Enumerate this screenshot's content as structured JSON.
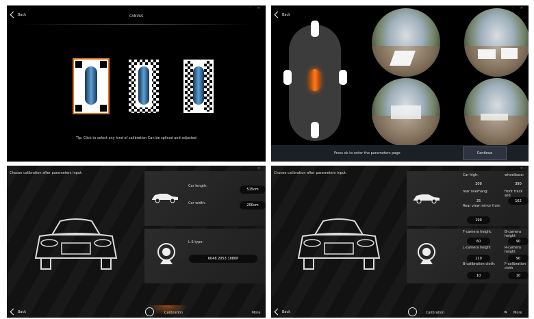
{
  "panel1": {
    "back_label": "Back",
    "title": "CANVAS",
    "tip": "Tip: Click to select any kind of calibration Can be spliced and adjusted",
    "window_controls": "- ×"
  },
  "panel2": {
    "back_label": "Back",
    "status_text": "Press ok to enter the parameters page",
    "continue_label": "Continue",
    "window_controls": "- ×"
  },
  "panel3": {
    "heading": "Choose calibration after parameters input:",
    "car_length_label": "Car length:",
    "car_length_value": "515cm",
    "car_width_label": "Car width:",
    "car_width_value": "200cm",
    "ls_type_label": "L-S type:",
    "ls_type_value": "6048 2053 1080P",
    "back_label": "Back",
    "calibration_label": "Calibration",
    "more_label": "More",
    "window_controls": "- ×"
  },
  "panel4": {
    "heading": "Choose calibration after parameters input:",
    "car_high_label": "Car high:",
    "car_high_value": "200",
    "wheelbase_label": "wheelbase:",
    "wheelbase_value": "390",
    "rear_overhang_label": "rear overhang:",
    "rear_overhang_value": "25",
    "front_track_label": "front track wid",
    "front_track_value": "162",
    "rear_view_label": "Rear view mirror from",
    "rear_view_value": "190",
    "f_camera_label": "F-camera height:",
    "f_camera_value": "60",
    "b_camera_label": "B-camera height",
    "b_camera_value": "90",
    "l_camera_label": "L-camera height",
    "l_camera_value": "110",
    "r_camera_label": "R-camera height",
    "r_camera_value": "90",
    "b_cloth_label": "B-calibration cloth:",
    "b_cloth_value": "10",
    "f_cloth_label": "F-calibration cloth",
    "f_cloth_value": "10",
    "back_label": "Back",
    "calibration_label": "Calibration",
    "more_label": "More",
    "window_controls": "- ×"
  },
  "colors": {
    "accent_orange": "#e8731a",
    "panel_bg": "#121212"
  }
}
